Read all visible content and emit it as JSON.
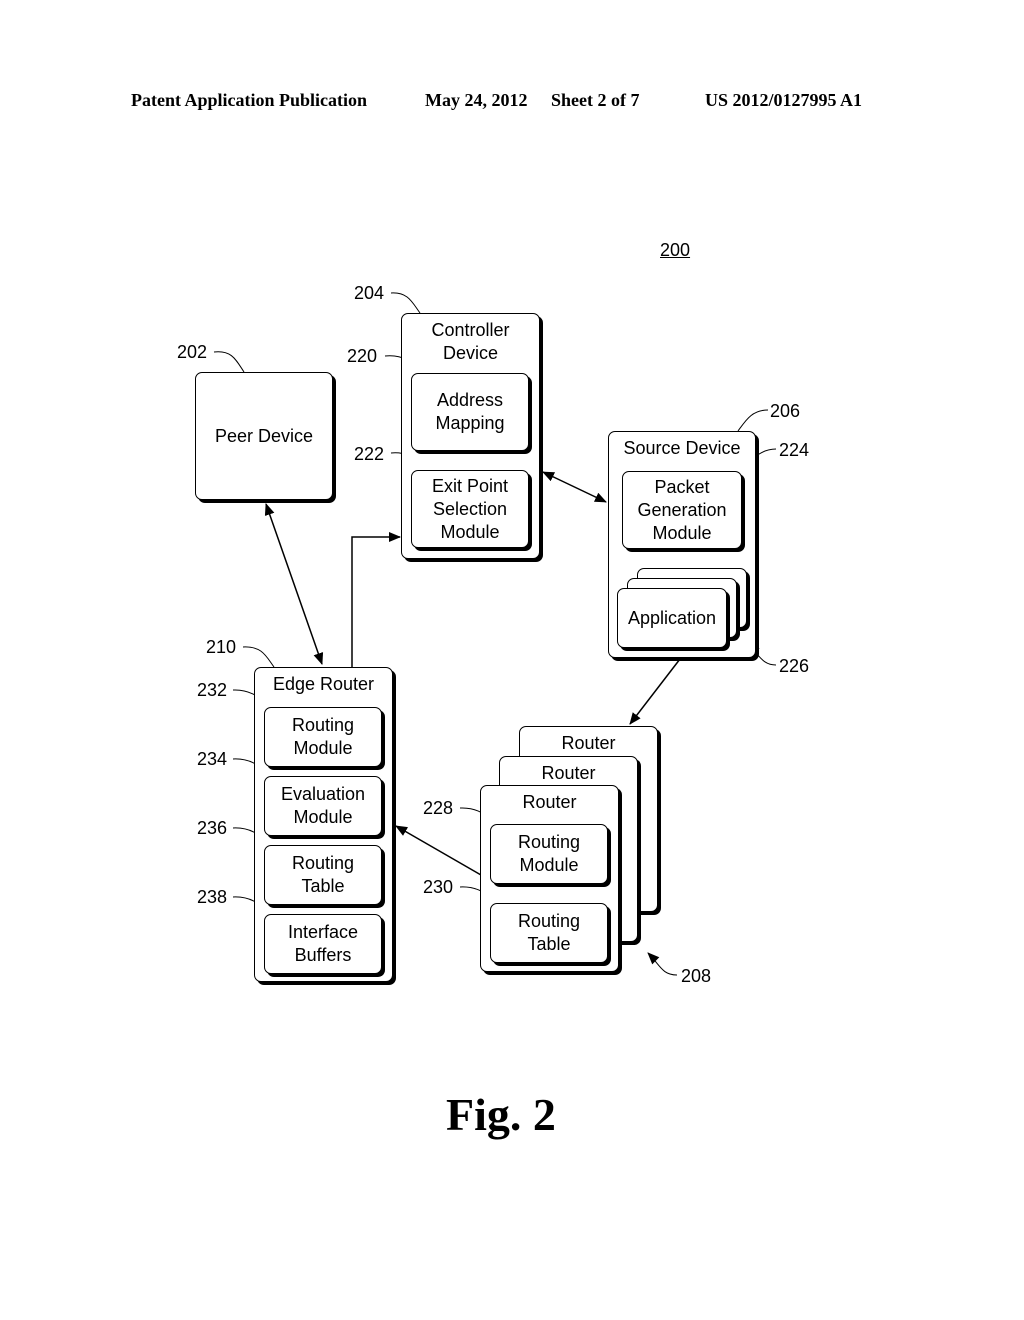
{
  "header": {
    "publication": "Patent Application Publication",
    "date": "May 24, 2012",
    "sheet": "Sheet 2 of 7",
    "number": "US 2012/0127995 A1"
  },
  "figure": {
    "number": "200",
    "caption": "Fig. 2"
  },
  "peer_device": {
    "ref": "202",
    "label": "Peer Device"
  },
  "controller_device": {
    "ref": "204",
    "title": "Controller Device",
    "modules": [
      {
        "ref": "220",
        "label": "Address Mapping"
      },
      {
        "ref": "222",
        "label": "Exit Point Selection Module"
      }
    ]
  },
  "source_device": {
    "ref": "206",
    "title": "Source Device",
    "modules": [
      {
        "ref": "224",
        "label": "Packet Generation Module"
      },
      {
        "ref": "226",
        "label": "Application"
      }
    ]
  },
  "routers": {
    "ref": "208",
    "titles": [
      "Router",
      "Router",
      "Router"
    ],
    "modules": [
      {
        "ref": "228",
        "label": "Routing Module"
      },
      {
        "ref": "230",
        "label": "Routing Table"
      }
    ]
  },
  "edge_router": {
    "ref": "210",
    "title": "Edge Router",
    "modules": [
      {
        "ref": "232",
        "label": "Routing Module"
      },
      {
        "ref": "234",
        "label": "Evaluation Module"
      },
      {
        "ref": "236",
        "label": "Routing Table"
      },
      {
        "ref": "238",
        "label": "Interface Buffers"
      }
    ]
  },
  "connections": [
    {
      "from": "edge_router",
      "to": "peer_device",
      "type": "bidirectional"
    },
    {
      "from": "edge_router",
      "to": "controller_device",
      "type": "directed"
    },
    {
      "from": "controller_device",
      "to": "source_device",
      "type": "bidirectional"
    },
    {
      "from": "source_device",
      "to": "routers",
      "type": "directed"
    },
    {
      "from": "routers",
      "to": "edge_router",
      "type": "directed"
    }
  ]
}
